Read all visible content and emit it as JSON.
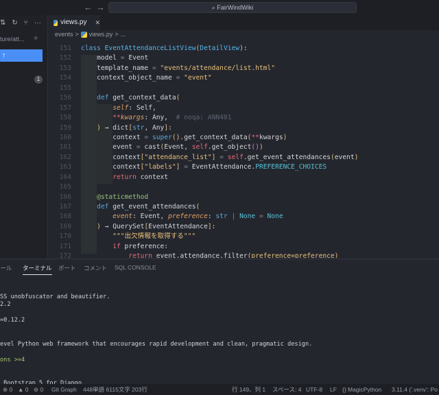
{
  "titlebar": {
    "search": "FairWindWiki",
    "back": "←",
    "forward": "→"
  },
  "sidebar": {
    "branch": "ture/att...",
    "badge": "1",
    "button_icon": "↑"
  },
  "tab": {
    "label": "views.py",
    "close": "✕"
  },
  "breadcrumb": [
    "events",
    ">",
    "views.py",
    ">",
    "..."
  ],
  "code": [
    {
      "n": "151",
      "t": [
        [
          "kw",
          "class "
        ],
        [
          "cls",
          "EventAttendanceListView"
        ],
        [
          "br",
          "("
        ],
        [
          "cls",
          "DetailView"
        ],
        [
          "br",
          ")"
        ],
        [
          "def",
          ":"
        ]
      ]
    },
    {
      "n": "152",
      "t": [
        [
          "def",
          "    model "
        ],
        [
          "op",
          "="
        ],
        [
          "def",
          " Event"
        ]
      ]
    },
    {
      "n": "153",
      "t": [
        [
          "def",
          "    template_name "
        ],
        [
          "op",
          "="
        ],
        [
          "str",
          " \"events/attendance/list.html\""
        ]
      ]
    },
    {
      "n": "154",
      "t": [
        [
          "def",
          "    context_object_name "
        ],
        [
          "op",
          "="
        ],
        [
          "str",
          " \"event\""
        ]
      ]
    },
    {
      "n": "155",
      "t": []
    },
    {
      "n": "156",
      "t": [
        [
          "kw",
          "    def "
        ],
        [
          "def",
          "get_context_data"
        ],
        [
          "br",
          "("
        ]
      ]
    },
    {
      "n": "157",
      "t": [
        [
          "self",
          "        self"
        ],
        [
          "def",
          ": Self,"
        ]
      ]
    },
    {
      "n": "158",
      "t": [
        [
          "red",
          "        **"
        ],
        [
          "self",
          "kwargs"
        ],
        [
          "def",
          ": Any,  "
        ],
        [
          "cm",
          "# noqa: ANN401"
        ]
      ]
    },
    {
      "n": "159",
      "t": [
        [
          "br",
          "    )"
        ],
        [
          "def",
          " → dict"
        ],
        [
          "br",
          "["
        ],
        [
          "bi",
          "str"
        ],
        [
          "def",
          ", Any"
        ],
        [
          "br",
          "]"
        ],
        [
          "def",
          ":"
        ]
      ]
    },
    {
      "n": "160",
      "t": [
        [
          "def",
          "        context "
        ],
        [
          "op",
          "="
        ],
        [
          "bi",
          " super"
        ],
        [
          "br",
          "()"
        ],
        [
          "def",
          ".get_context_data"
        ],
        [
          "br",
          "("
        ],
        [
          "red",
          "**"
        ],
        [
          "def",
          "kwargs"
        ],
        [
          "br",
          ")"
        ]
      ]
    },
    {
      "n": "161",
      "t": [
        [
          "def",
          "        event "
        ],
        [
          "op",
          "="
        ],
        [
          "def",
          " cast"
        ],
        [
          "br",
          "("
        ],
        [
          "def",
          "Event, "
        ],
        [
          "red",
          "self"
        ],
        [
          "def",
          ".get_object"
        ],
        [
          "pl",
          "()"
        ],
        [
          "br",
          ")"
        ]
      ]
    },
    {
      "n": "162",
      "t": [
        [
          "def",
          "        context"
        ],
        [
          "br",
          "["
        ],
        [
          "str",
          "\"attendance_list\""
        ],
        [
          "br",
          "]"
        ],
        [
          "op",
          " ="
        ],
        [
          "red",
          " self"
        ],
        [
          "def",
          ".get_event_attendances"
        ],
        [
          "br",
          "("
        ],
        [
          "def",
          "event"
        ],
        [
          "br",
          ")"
        ]
      ]
    },
    {
      "n": "163",
      "t": [
        [
          "def",
          "        context"
        ],
        [
          "br",
          "["
        ],
        [
          "str",
          "\"labels\""
        ],
        [
          "br",
          "]"
        ],
        [
          "op",
          " ="
        ],
        [
          "def",
          " EventAttendance."
        ],
        [
          "const",
          "PREFERENCE_CHOICES"
        ]
      ]
    },
    {
      "n": "164",
      "t": [
        [
          "red",
          "        return"
        ],
        [
          "def",
          " context"
        ]
      ]
    },
    {
      "n": "165",
      "t": []
    },
    {
      "n": "166",
      "t": [
        [
          "dec",
          "    @staticmethod"
        ]
      ]
    },
    {
      "n": "167",
      "t": [
        [
          "kw",
          "    def "
        ],
        [
          "def",
          "get_event_attendances"
        ],
        [
          "br",
          "("
        ]
      ]
    },
    {
      "n": "168",
      "t": [
        [
          "self",
          "        event"
        ],
        [
          "def",
          ": Event, "
        ],
        [
          "self",
          "preference"
        ],
        [
          "def",
          ": "
        ],
        [
          "bi",
          "str"
        ],
        [
          "op",
          " | "
        ],
        [
          "const",
          "None"
        ],
        [
          "op",
          " = "
        ],
        [
          "const",
          "None"
        ]
      ]
    },
    {
      "n": "169",
      "t": [
        [
          "br",
          "    )"
        ],
        [
          "def",
          " → QuerySet"
        ],
        [
          "br",
          "["
        ],
        [
          "def",
          "EventAttendance"
        ],
        [
          "br",
          "]"
        ],
        [
          "def",
          ":"
        ]
      ]
    },
    {
      "n": "170",
      "t": [
        [
          "str",
          "        \"\"\"出欠情報を取得する\"\"\""
        ]
      ]
    },
    {
      "n": "171",
      "t": [
        [
          "red",
          "        if"
        ],
        [
          "def",
          " preference:"
        ]
      ]
    },
    {
      "n": "172",
      "t": [
        [
          "red",
          "            return"
        ],
        [
          "def",
          " event.attendance.filter"
        ],
        [
          "br",
          "("
        ],
        [
          "str",
          "preference=preference"
        ],
        [
          "br",
          ")"
        ]
      ]
    }
  ],
  "panel": {
    "tabs": [
      "ツール",
      "ターミナル",
      "ポート",
      "コメント",
      "SQL CONSOLE"
    ],
    "active": "ターミナル"
  },
  "terminal": [
    "",
    "SS unobfuscator and beautifier.",
    "2.2",
    "",
    "=0.12.2",
    "",
    "",
    "evel Python web framework that encourages rapid development and clean, pragmatic design.",
    "",
    "ons >=4",
    "",
    "",
    " Bootstrap 5 for Django"
  ],
  "status": {
    "errors": "⊗ 0",
    "warnings": "▲ 0",
    "ports": "⊚ 0",
    "git_graph": "Git Graph",
    "counts": "448単語 6115文字 203行",
    "position": "行 149、列 1",
    "spaces": "スペース: 4",
    "encoding": "UTF-8",
    "eol": "LF",
    "language": "{} MagicPython",
    "python": "3.11.4 ('.venv': Po"
  }
}
